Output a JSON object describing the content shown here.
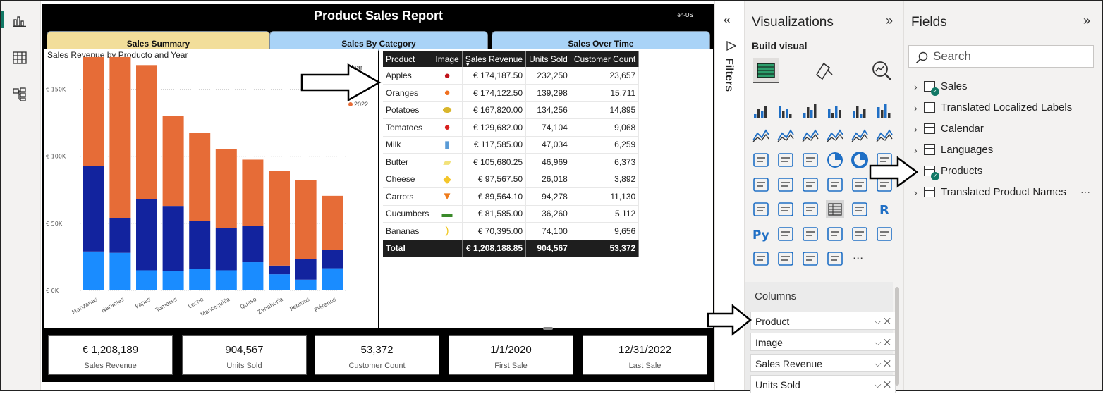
{
  "report": {
    "title": "Product Sales Report",
    "locale": "en-US",
    "tabs": [
      "Sales Summary",
      "Sales By Category",
      "Sales Over Time"
    ]
  },
  "chart": {
    "title": "Sales Revenue by Producto and Year",
    "legend_title": "Year",
    "legend_item": "2022",
    "y_ticks": [
      "€ 150K",
      "€ 100K",
      "€ 50K",
      "€ 0K"
    ]
  },
  "chart_data": {
    "type": "bar",
    "stacked": true,
    "title": "Sales Revenue by Producto and Year",
    "categories": [
      "Manzanas",
      "Naranjas",
      "Papas",
      "Tomates",
      "Leche",
      "Mantequilla",
      "Queso",
      "Zanahoria",
      "Pepinos",
      "Plátanos"
    ],
    "series": [
      {
        "name": "",
        "color": "#1a8cff",
        "values": [
          29000,
          28000,
          15000,
          14500,
          16000,
          15000,
          21000,
          12000,
          8000,
          16500
        ]
      },
      {
        "name": "",
        "color": "#12239e",
        "values": [
          64000,
          26000,
          53000,
          48500,
          35500,
          31500,
          27000,
          6500,
          15500,
          13500
        ]
      },
      {
        "name": "2022",
        "color": "#e66c37",
        "values": [
          81000,
          120000,
          100000,
          67000,
          66000,
          59000,
          49500,
          70500,
          58500,
          40500
        ]
      }
    ],
    "ylim": [
      0,
      175000
    ],
    "y_ticks": [
      0,
      50000,
      100000,
      150000
    ],
    "legend": "top-right",
    "grid": true
  },
  "table": {
    "headers": [
      "Product",
      "Image",
      "Sales Revenue",
      "Units Sold",
      "Customer Count"
    ],
    "rows": [
      {
        "product": "Apples",
        "img": "apple",
        "revenue": "€ 174,187.50",
        "units": "232,250",
        "customers": "23,657"
      },
      {
        "product": "Oranges",
        "img": "orange",
        "revenue": "€ 174,122.50",
        "units": "139,298",
        "customers": "15,711"
      },
      {
        "product": "Potatoes",
        "img": "potato",
        "revenue": "€ 167,820.00",
        "units": "134,256",
        "customers": "14,895"
      },
      {
        "product": "Tomatoes",
        "img": "tomato",
        "revenue": "€ 129,682.00",
        "units": "74,104",
        "customers": "9,068"
      },
      {
        "product": "Milk",
        "img": "milk",
        "revenue": "€ 117,585.00",
        "units": "47,034",
        "customers": "6,259"
      },
      {
        "product": "Butter",
        "img": "butter",
        "revenue": "€ 105,680.25",
        "units": "46,969",
        "customers": "6,373"
      },
      {
        "product": "Cheese",
        "img": "cheese",
        "revenue": "€ 97,567.50",
        "units": "26,018",
        "customers": "3,892"
      },
      {
        "product": "Carrots",
        "img": "carrot",
        "revenue": "€ 89,564.10",
        "units": "94,278",
        "customers": "11,130"
      },
      {
        "product": "Cucumbers",
        "img": "cucumber",
        "revenue": "€ 81,585.00",
        "units": "36,260",
        "customers": "5,112"
      },
      {
        "product": "Bananas",
        "img": "banana",
        "revenue": "€ 70,395.00",
        "units": "74,100",
        "customers": "9,656"
      }
    ],
    "total": {
      "label": "Total",
      "revenue": "€ 1,208,188.85",
      "units": "904,567",
      "customers": "53,372"
    }
  },
  "cards": [
    {
      "value": "€ 1,208,189",
      "label": "Sales Revenue"
    },
    {
      "value": "904,567",
      "label": "Units Sold"
    },
    {
      "value": "53,372",
      "label": "Customer Count"
    },
    {
      "value": "1/1/2020",
      "label": "First Sale"
    },
    {
      "value": "12/31/2022",
      "label": "Last Sale"
    }
  ],
  "filters": {
    "label": "Filters"
  },
  "visualizations": {
    "title": "Visualizations",
    "build_visual": "Build visual",
    "columns_label": "Columns",
    "wells": [
      "Product",
      "Image",
      "Sales Revenue",
      "Units Sold"
    ]
  },
  "fields": {
    "title": "Fields",
    "search_placeholder": "Search",
    "items": [
      {
        "label": "Sales",
        "checked": true
      },
      {
        "label": "Translated Localized Labels",
        "checked": false
      },
      {
        "label": "Calendar",
        "checked": false
      },
      {
        "label": "Languages",
        "checked": false
      },
      {
        "label": "Products",
        "checked": true
      },
      {
        "label": "Translated Product Names",
        "checked": false
      }
    ],
    "more": "···"
  },
  "colors": {
    "orange": "#e66c37",
    "darkblue": "#12239e",
    "lightblue": "#1a8cff",
    "tab_active": "#f2de9a",
    "tab_inactive": "#a9d3f7",
    "accent": "#117865"
  }
}
